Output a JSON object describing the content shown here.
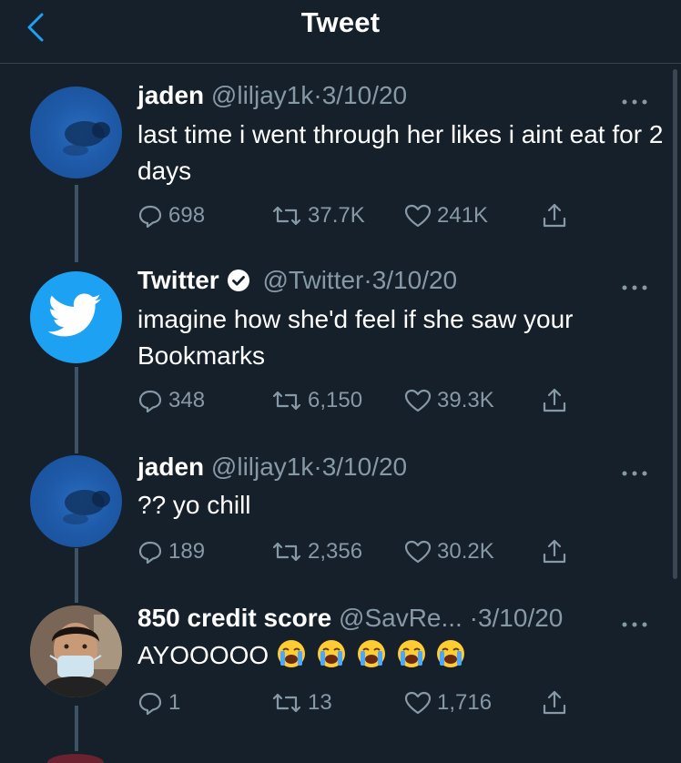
{
  "header": {
    "title": "Tweet",
    "back_icon": "chevron-left-icon"
  },
  "colors": {
    "background": "#15202b",
    "accent": "#1da1f2",
    "muted": "#8899a6",
    "border": "#38444d"
  },
  "tweets": [
    {
      "name": "jaden",
      "handle": "@liljay1k",
      "date": "3/10/20",
      "text": "last time i went through her likes i aint eat for 2 days",
      "replies": "698",
      "retweets": "37.7K",
      "likes": "241K"
    },
    {
      "name": "Twitter",
      "verified": true,
      "handle": "@Twitter",
      "date": "3/10/20",
      "text": "imagine how she'd feel if she saw your Bookmarks",
      "replies": "348",
      "retweets": "6,150",
      "likes": "39.3K"
    },
    {
      "name": "jaden",
      "handle": "@liljay1k",
      "date": "3/10/20",
      "text": "?? yo chill",
      "replies": "189",
      "retweets": "2,356",
      "likes": "30.2K"
    },
    {
      "name": "850 credit score",
      "handle": "@SavRe...",
      "date": "3/10/20",
      "text": "AYOOOOO",
      "emojis": [
        "crying-face-emoji",
        "crying-face-emoji",
        "crying-face-emoji",
        "crying-face-emoji",
        "crying-face-emoji"
      ],
      "replies": "1",
      "retweets": "13",
      "likes": "1,716"
    }
  ],
  "separator": "·"
}
